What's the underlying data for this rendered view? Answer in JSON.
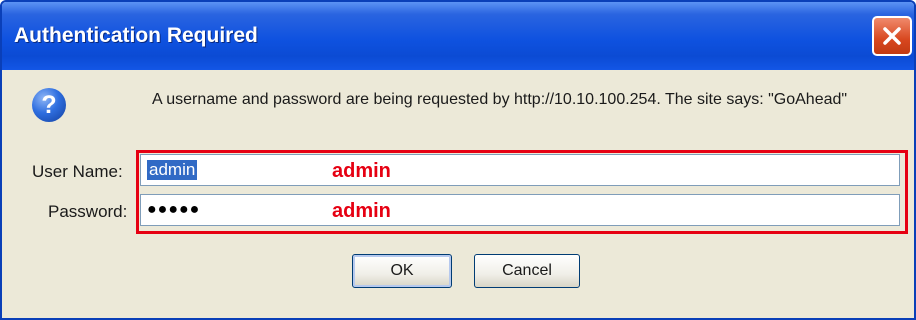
{
  "dialog": {
    "title": "Authentication Required",
    "close_icon": "close-icon",
    "question_icon": "question-icon",
    "question_glyph": "?",
    "message": "A username and password are being requested by http://10.10.100.254. The site says: \"GoAhead\""
  },
  "form": {
    "username_label": "User Name:",
    "username_value": "admin",
    "password_label": "Password:",
    "password_mask": "●●●●●"
  },
  "annotations": {
    "username_note": "admin",
    "password_note": "admin",
    "highlight_color": "#e60012"
  },
  "buttons": {
    "ok_label": "OK",
    "cancel_label": "Cancel"
  },
  "colors": {
    "titlebar": "#0b4bd4",
    "close_button": "#d8471f",
    "dialog_background": "#ece9d8",
    "selection": "#316ac5"
  }
}
